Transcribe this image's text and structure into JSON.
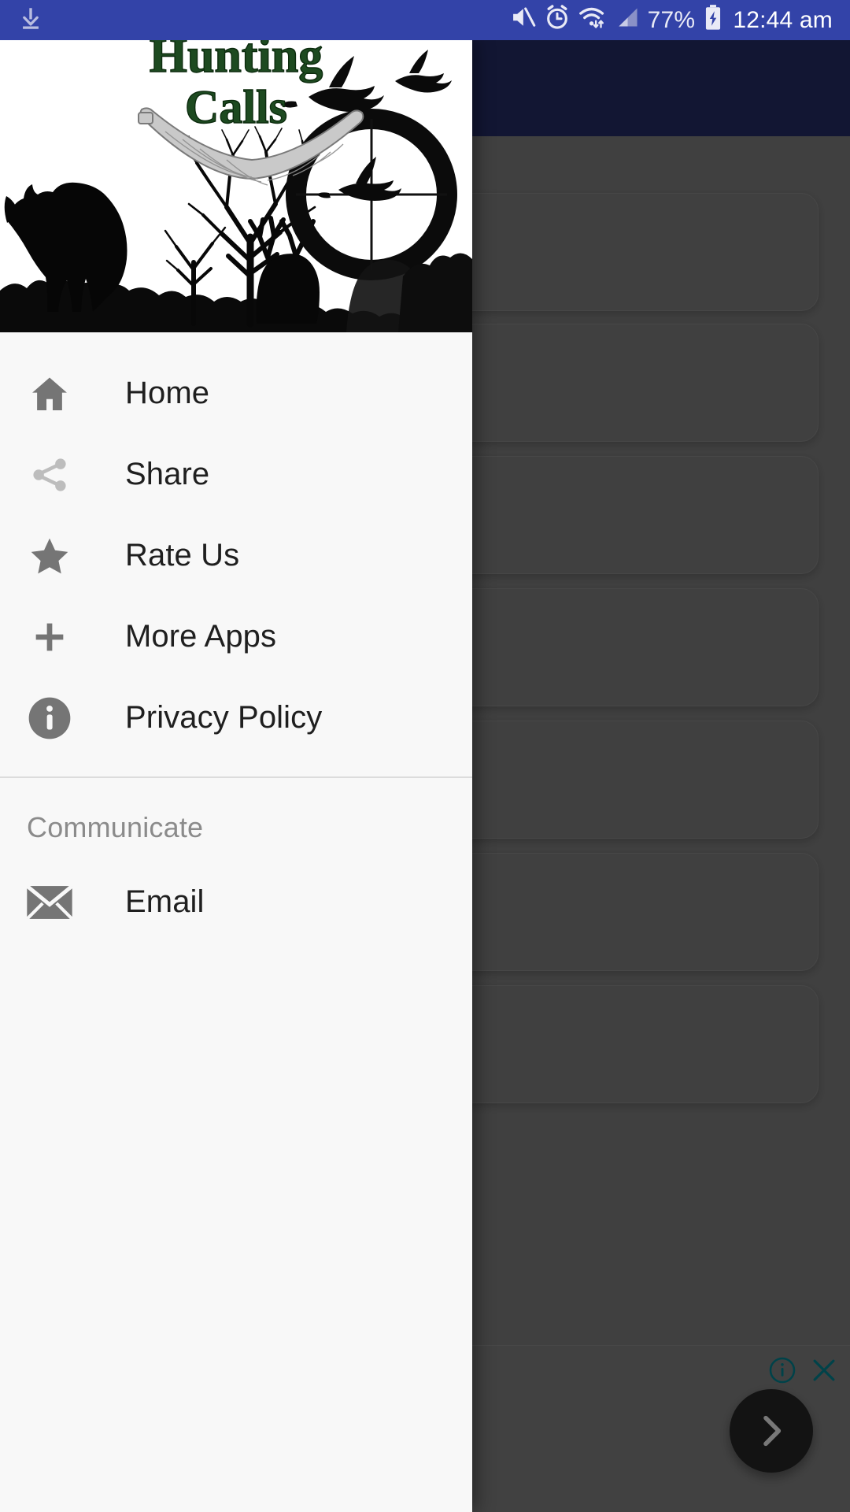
{
  "status_bar": {
    "background_color": "#3343a8",
    "left_icons": [
      {
        "name": "download-icon",
        "label": "download"
      }
    ],
    "right_icons": [
      {
        "name": "mute-icon",
        "label": "sound off"
      },
      {
        "name": "alarm-icon",
        "label": "alarm set"
      },
      {
        "name": "wifi-icon",
        "label": "wifi"
      },
      {
        "name": "signal-icon",
        "label": "cellular signal"
      }
    ],
    "battery_percent": "77%",
    "battery_state": "charging",
    "time": "12:44 am"
  },
  "drawer": {
    "header": {
      "title_line1": "Hunting",
      "title_line2": "Calls",
      "title_color": "#1d4a20",
      "artwork": "hunting-scene-silhouette"
    },
    "items": [
      {
        "label": "Home",
        "icon": "home-icon"
      },
      {
        "label": "Share",
        "icon": "share-icon"
      },
      {
        "label": "Rate Us",
        "icon": "star-icon"
      },
      {
        "label": "More Apps",
        "icon": "plus-icon"
      },
      {
        "label": "Privacy Policy",
        "icon": "info-circle-icon"
      }
    ],
    "section": {
      "title": "Communicate",
      "items": [
        {
          "label": "Email",
          "icon": "email-icon"
        }
      ]
    }
  },
  "background": {
    "toolbar_color": "#1f2759",
    "scrim_color": "rgba(0,0,0,0.42)",
    "cards_count": 7,
    "ad": {
      "info_icon": "ad-info-icon",
      "close_icon": "ad-close-icon",
      "accent_color": "#00737f"
    },
    "fab": {
      "icon": "chevron-right-icon",
      "color": "#212121"
    }
  }
}
